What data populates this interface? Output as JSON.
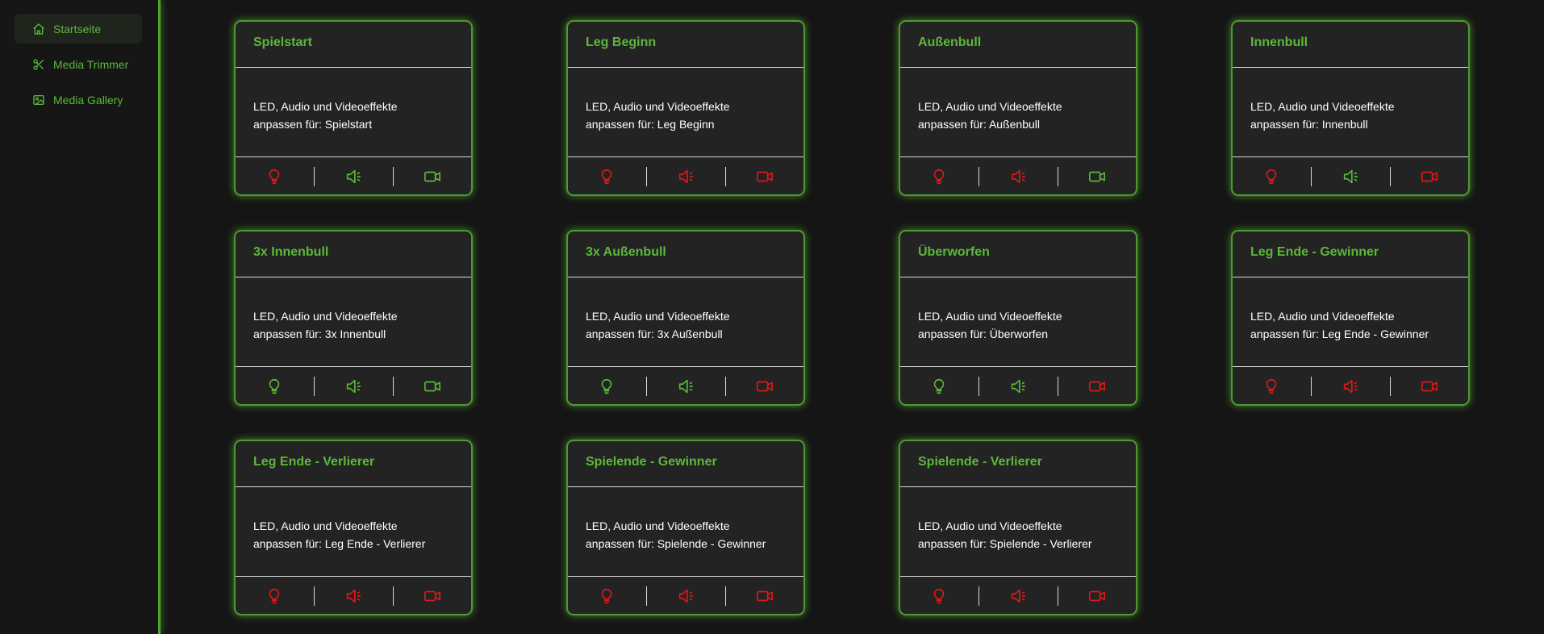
{
  "sidebar": {
    "items": [
      {
        "label": "Startseite",
        "icon": "home-icon",
        "active": true
      },
      {
        "label": "Media Trimmer",
        "icon": "scissors-icon",
        "active": false
      },
      {
        "label": "Media Gallery",
        "icon": "image-icon",
        "active": false
      }
    ]
  },
  "colors": {
    "accent": "#5cb83a",
    "enabled": "#5cb83a",
    "disabled": "#e01818",
    "card_bg": "#232323",
    "page_bg": "#151515"
  },
  "cards": [
    {
      "title": "Spielstart",
      "desc_line1": "LED, Audio und Videoeffekte",
      "desc_line2": "anpassen für: Spielstart",
      "led": "off",
      "audio": "on",
      "video": "on"
    },
    {
      "title": "Leg Beginn",
      "desc_line1": "LED, Audio und Videoeffekte",
      "desc_line2": "anpassen für: Leg Beginn",
      "led": "off",
      "audio": "off",
      "video": "off"
    },
    {
      "title": "Außenbull",
      "desc_line1": "LED, Audio und Videoeffekte",
      "desc_line2": "anpassen für: Außenbull",
      "led": "off",
      "audio": "off",
      "video": "on"
    },
    {
      "title": "Innenbull",
      "desc_line1": "LED, Audio und Videoeffekte",
      "desc_line2": "anpassen für: Innenbull",
      "led": "off",
      "audio": "on",
      "video": "off"
    },
    {
      "title": "3x Innenbull",
      "desc_line1": "LED, Audio und Videoeffekte",
      "desc_line2": "anpassen für: 3x Innenbull",
      "led": "on",
      "audio": "on",
      "video": "on"
    },
    {
      "title": "3x Außenbull",
      "desc_line1": "LED, Audio und Videoeffekte",
      "desc_line2": "anpassen für: 3x Außenbull",
      "led": "on",
      "audio": "on",
      "video": "off"
    },
    {
      "title": "Überworfen",
      "desc_line1": "LED, Audio und Videoeffekte",
      "desc_line2": "anpassen für: Überworfen",
      "led": "on",
      "audio": "on",
      "video": "off"
    },
    {
      "title": "Leg Ende - Gewinner",
      "desc_line1": "LED, Audio und Videoeffekte",
      "desc_line2": "anpassen für: Leg Ende - Gewinner",
      "led": "off",
      "audio": "off",
      "video": "off"
    },
    {
      "title": "Leg Ende - Verlierer",
      "desc_line1": "LED, Audio und Videoeffekte",
      "desc_line2": "anpassen für: Leg Ende - Verlierer",
      "led": "off",
      "audio": "off",
      "video": "off"
    },
    {
      "title": "Spielende - Gewinner",
      "desc_line1": "LED, Audio und Videoeffekte",
      "desc_line2": "anpassen für: Spielende - Gewinner",
      "led": "off",
      "audio": "off",
      "video": "off"
    },
    {
      "title": "Spielende - Verlierer",
      "desc_line1": "LED, Audio und Videoeffekte",
      "desc_line2": "anpassen für: Spielende - Verlierer",
      "led": "off",
      "audio": "off",
      "video": "off"
    }
  ]
}
